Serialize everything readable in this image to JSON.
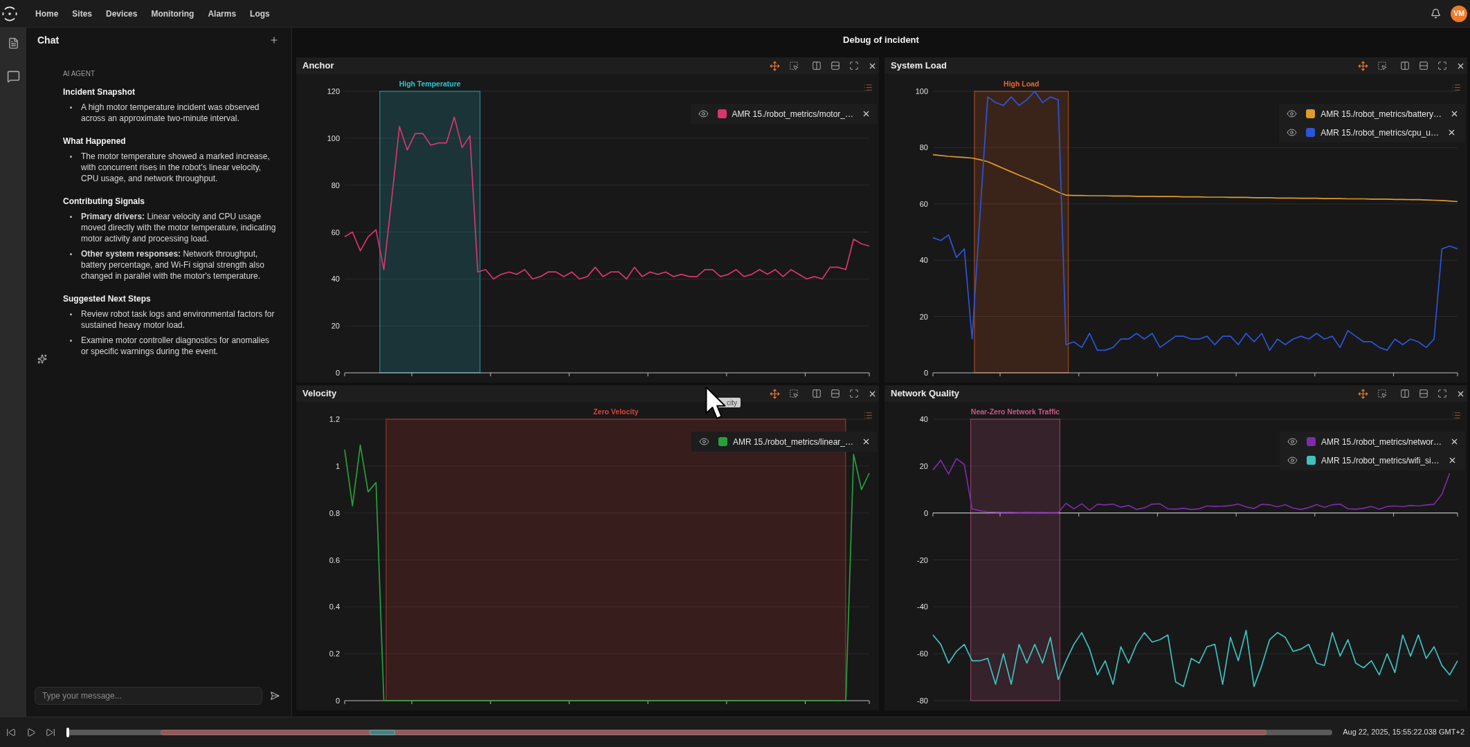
{
  "nav": {
    "items": [
      "Home",
      "Sites",
      "Devices",
      "Monitoring",
      "Alarms",
      "Logs"
    ]
  },
  "user": {
    "initials": "VM"
  },
  "chat": {
    "title": "Chat",
    "author": "AI AGENT",
    "sections": [
      {
        "heading": "Incident Snapshot",
        "bullets": [
          "A high motor temperature incident was observed across an approximate two-minute interval."
        ]
      },
      {
        "heading": "What Happened",
        "bullets": [
          "The motor temperature showed a marked increase, with concurrent rises in the robot's linear velocity, CPU usage, and network throughput."
        ]
      },
      {
        "heading": "Contributing Signals",
        "bullets": [
          "**Primary drivers:** Linear velocity and CPU usage moved directly with the motor temperature, indicating motor activity and processing load.",
          "**Other system responses:** Network throughput, battery percentage, and Wi-Fi signal strength also changed in parallel with the motor's temperature."
        ]
      },
      {
        "heading": "Suggested Next Steps",
        "bullets": [
          "Review robot task logs and environmental factors for sustained heavy motor load.",
          "Examine motor controller diagnostics for anomalies or specific warnings during the event."
        ]
      }
    ],
    "input": {
      "placeholder": "Type your message..."
    }
  },
  "main": {
    "title": "Debug of incident",
    "panels": [
      {
        "title": "Anchor",
        "highlight": {
          "label": "High Temperature",
          "color": "#2ec4d4"
        },
        "chart_data": {
          "type": "line",
          "ylim": [
            0,
            120
          ],
          "yticks": [
            0,
            20,
            40,
            60,
            80,
            100,
            120
          ],
          "grid": true,
          "legend": "upper right",
          "series": [
            {
              "name": "AMR 15./robot_metrics/motor_…",
              "color": "#d9366f",
              "values": [
                58,
                60,
                52,
                58,
                61,
                44,
                74,
                105,
                95,
                102,
                102,
                97,
                98,
                98,
                109,
                96,
                101,
                43,
                44,
                40,
                42,
                43,
                42,
                44,
                40,
                41,
                43,
                43,
                41,
                43,
                40,
                41,
                45,
                41,
                43,
                43,
                40,
                45,
                41,
                43,
                42,
                43,
                41,
                42,
                41,
                41,
                44,
                44,
                41,
                42,
                44,
                41,
                42,
                44,
                42,
                44,
                41,
                44,
                42,
                40,
                41,
                40,
                45,
                45,
                44,
                57,
                55,
                54
              ]
            }
          ]
        }
      },
      {
        "title": "System Load",
        "highlight": {
          "label": "High Load",
          "color": "#e8672a"
        },
        "chart_data": {
          "type": "line",
          "ylim": [
            0,
            100
          ],
          "yticks": [
            0,
            20,
            40,
            60,
            80,
            100
          ],
          "grid": true,
          "legend": "upper right",
          "series": [
            {
              "name": "AMR 15./robot_metrics/battery…",
              "color": "#e09b2c",
              "values": [
                77.5,
                77.2,
                76.9,
                76.7,
                76.5,
                76.3,
                75.7,
                75.0,
                73.8,
                72.6,
                71.4,
                70.2,
                69.1,
                67.9,
                66.8,
                65.5,
                64.2,
                63.1,
                63.0,
                63.0,
                62.9,
                62.9,
                62.9,
                62.8,
                62.8,
                62.8,
                62.7,
                62.7,
                62.7,
                62.6,
                62.6,
                62.6,
                62.5,
                62.5,
                62.5,
                62.4,
                62.4,
                62.4,
                62.3,
                62.3,
                62.3,
                62.2,
                62.2,
                62.2,
                62.1,
                62.1,
                62.1,
                62.0,
                62.0,
                62.0,
                61.9,
                61.9,
                61.9,
                61.8,
                61.8,
                61.8,
                61.7,
                61.7,
                61.7,
                61.6,
                61.6,
                61.5,
                61.5,
                61.4,
                61.3,
                61.2,
                61.0,
                60.8
              ]
            },
            {
              "name": "AMR 15./robot_metrics/cpu_u…",
              "color": "#2c55d8",
              "values": [
                48,
                47,
                49,
                41,
                44,
                12,
                56,
                98,
                96,
                95,
                98,
                95,
                97,
                100,
                96,
                98,
                97,
                10,
                11,
                9,
                14,
                8,
                8,
                9,
                12,
                12,
                14,
                12,
                14,
                9,
                11,
                13,
                13,
                12,
                12,
                13,
                10,
                13,
                13,
                10,
                14,
                11,
                14,
                8,
                12,
                10,
                12,
                13,
                12,
                14,
                12,
                13,
                9,
                15,
                13,
                11,
                11,
                9,
                8,
                12,
                10,
                12,
                11,
                9,
                12,
                44,
                45,
                44
              ]
            }
          ]
        }
      },
      {
        "title": "Velocity",
        "highlight": {
          "label": "Zero Velocity",
          "color": "#d8443a"
        },
        "chart_data": {
          "type": "line",
          "ylim": [
            0,
            1.2
          ],
          "yticks": [
            0,
            0.2,
            0.4,
            0.6,
            0.8,
            1,
            1.2
          ],
          "grid": true,
          "legend": "upper right",
          "series": [
            {
              "name": "AMR 15./robot_metrics/linear_…",
              "color": "#27a03a",
              "values": [
                1.07,
                0.83,
                1.09,
                0.89,
                0.93,
                0,
                0,
                0,
                0,
                0,
                0,
                0,
                0,
                0,
                0,
                0,
                0,
                0,
                0,
                0,
                0,
                0,
                0,
                0,
                0,
                0,
                0,
                0,
                0,
                0,
                0,
                0,
                0,
                0,
                0,
                0,
                0,
                0,
                0,
                0,
                0,
                0,
                0,
                0,
                0,
                0,
                0,
                0,
                0,
                0,
                0,
                0,
                0,
                0,
                0,
                0,
                0,
                0,
                0,
                0,
                0,
                0,
                0,
                0,
                0,
                1.05,
                0.9,
                0.97
              ]
            }
          ]
        }
      },
      {
        "title": "Network Quality",
        "highlight": {
          "label": "Near-Zero Network Traffic",
          "color": "#c9598a"
        },
        "chart_data": {
          "type": "line",
          "ylim": [
            -80,
            40
          ],
          "yticks": [
            -80,
            -60,
            -40,
            -20,
            0,
            20,
            40
          ],
          "grid": true,
          "legend": "upper right",
          "series": [
            {
              "name": "AMR 15./robot_metrics/networ…",
              "color": "#7d2ba8",
              "values": [
                18.3,
                22.5,
                16.6,
                23.2,
                20.7,
                1.8,
                1.0,
                0.5,
                0.4,
                0.3,
                0.3,
                0.2,
                0.3,
                0.2,
                0.3,
                0.2,
                0.2,
                4.1,
                1.8,
                3.9,
                1.2,
                3.7,
                3.5,
                3.8,
                2.5,
                3.2,
                1.5,
                2.2,
                3.8,
                3.9,
                1.8,
                1.6,
                2.0,
                1.5,
                1.8,
                3.0,
                2.8,
                2.9,
                3.2,
                3.8,
                2.6,
                1.9,
                3.7,
                3.5,
                2.6,
                3.5,
                2.1,
                1.5,
                2.3,
                3.6,
                2.4,
                3.5,
                3.8,
                1.8,
                1.6,
                2.0,
                2.8,
                1.6,
                2.8,
                3.0,
                2.7,
                3.2,
                3.0,
                3.4,
                3.7,
                8.0,
                17.0,
                null
              ]
            },
            {
              "name": "AMR 15./robot_metrics/wifi_si…",
              "color": "#3fc1bf",
              "values": [
                -52,
                -56,
                -64,
                -59,
                -56,
                -63,
                -63,
                -62,
                -73,
                -60,
                -73,
                -56,
                -64,
                -56,
                -64,
                -53,
                -71,
                -63,
                -56,
                -51,
                -58,
                -69,
                -63,
                -73,
                -57,
                -64,
                -56,
                -51,
                -55,
                -54,
                -52,
                -72,
                -74,
                -62,
                -64,
                -57,
                -56,
                -73,
                -53,
                -63,
                -50,
                -74,
                -65,
                -54,
                -51,
                -53,
                -59,
                -58,
                -56,
                -64,
                -65,
                -51,
                -61,
                -54,
                -64,
                -66,
                -63,
                -69,
                -60,
                -68,
                -52,
                -61,
                -52,
                -62,
                -57,
                -65,
                -69,
                -63
              ]
            }
          ]
        }
      }
    ]
  },
  "tooltip": {
    "text": "city"
  },
  "timeline": {
    "level": 0,
    "timestamp": "Aug 22, 2025, 15:55:22.038 GMT+2"
  }
}
